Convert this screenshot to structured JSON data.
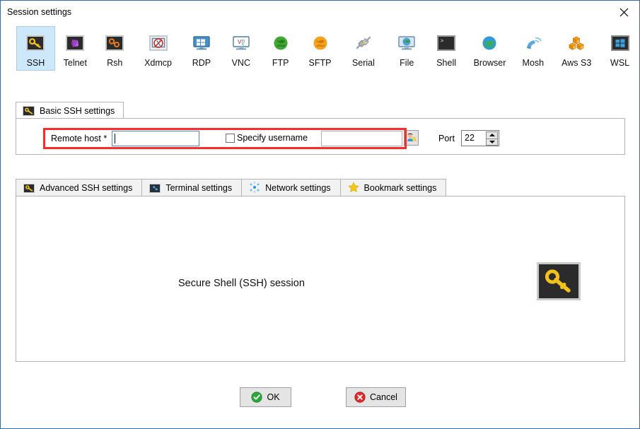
{
  "window": {
    "title": "Session settings",
    "close_icon": "close-icon",
    "accent_border": "#2a6fb5"
  },
  "session_types": [
    {
      "id": "ssh",
      "label": "SSH",
      "icon": "ssh-key-icon",
      "selected": true
    },
    {
      "id": "telnet",
      "label": "Telnet",
      "icon": "telnet-gem-icon",
      "selected": false
    },
    {
      "id": "rsh",
      "label": "Rsh",
      "icon": "rsh-gears-icon",
      "selected": false
    },
    {
      "id": "xdmcp",
      "label": "Xdmcp",
      "icon": "xdmcp-monitor-icon",
      "selected": false
    },
    {
      "id": "rdp",
      "label": "RDP",
      "icon": "rdp-monitor-icon",
      "selected": false
    },
    {
      "id": "vnc",
      "label": "VNC",
      "icon": "vnc-monitor-icon",
      "selected": false
    },
    {
      "id": "ftp",
      "label": "FTP",
      "icon": "ftp-globe-icon",
      "selected": false
    },
    {
      "id": "sftp",
      "label": "SFTP",
      "icon": "sftp-globe-icon",
      "selected": false
    },
    {
      "id": "serial",
      "label": "Serial",
      "icon": "serial-plug-icon",
      "selected": false
    },
    {
      "id": "file",
      "label": "File",
      "icon": "file-monitor-icon",
      "selected": false
    },
    {
      "id": "shell",
      "label": "Shell",
      "icon": "shell-prompt-icon",
      "selected": false
    },
    {
      "id": "browser",
      "label": "Browser",
      "icon": "browser-globe-icon",
      "selected": false
    },
    {
      "id": "mosh",
      "label": "Mosh",
      "icon": "mosh-satellite-icon",
      "selected": false
    },
    {
      "id": "awss3",
      "label": "Aws S3",
      "icon": "aws-s3-boxes-icon",
      "selected": false
    },
    {
      "id": "wsl",
      "label": "WSL",
      "icon": "wsl-windows-icon",
      "selected": false
    }
  ],
  "basic_tab": {
    "label": "Basic SSH settings",
    "icon": "ssh-key-icon"
  },
  "basic_form": {
    "remote_host_label": "Remote host *",
    "remote_host_value": "",
    "remote_host_placeholder": "",
    "specify_username_label": "Specify username",
    "specify_username_checked": false,
    "username_value": "",
    "username_placeholder": "",
    "user_picker_icon": "user-credentials-icon",
    "port_label": "Port",
    "port_value": "22",
    "spinner_up_icon": "spinner-up-icon",
    "spinner_down_icon": "spinner-down-icon",
    "highlight_color": "#ff2a2a"
  },
  "lower_tabs": [
    {
      "id": "advanced",
      "label": "Advanced SSH settings",
      "icon": "ssh-key-icon"
    },
    {
      "id": "terminal",
      "label": "Terminal settings",
      "icon": "terminal-settings-icon"
    },
    {
      "id": "network",
      "label": "Network settings",
      "icon": "network-nodes-icon"
    },
    {
      "id": "bookmark",
      "label": "Bookmark settings",
      "icon": "star-icon"
    }
  ],
  "lower_panel": {
    "caption": "Secure Shell (SSH) session",
    "illustration_icon": "ssh-key-large-icon"
  },
  "footer": {
    "ok_label": "OK",
    "ok_icon": "check-circle-icon",
    "cancel_label": "Cancel",
    "cancel_icon": "x-circle-icon"
  }
}
